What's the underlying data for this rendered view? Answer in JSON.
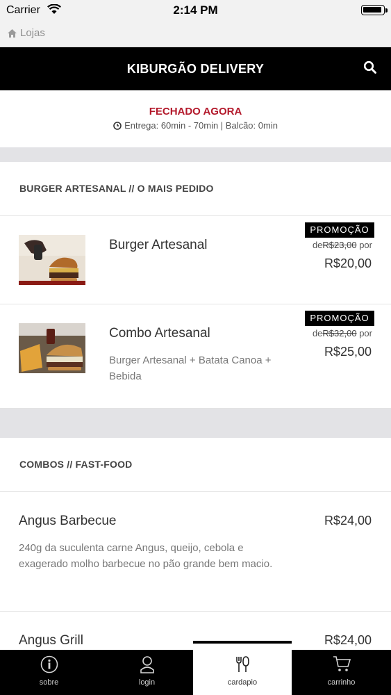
{
  "status_bar": {
    "carrier": "Carrier",
    "time": "2:14 PM",
    "battery_level": 0.95
  },
  "nav": {
    "back_label": "Lojas"
  },
  "header": {
    "title": "KIBURGÃO DELIVERY",
    "search_icon": "search-icon"
  },
  "store": {
    "status": "FECHADO AGORA",
    "delivery_info": "Entrega: 60min - 70min | Balcão: 0min",
    "status_color": "#b3192b"
  },
  "sections": [
    {
      "title": "BURGER ARTESANAL // O MAIS PEDIDO",
      "items": [
        {
          "name": "Burger Artesanal",
          "badge": "PROMOÇÃO",
          "old_prefix": "de",
          "old_price": "R$23,00",
          "old_suffix": "por",
          "price": "R$20,00"
        },
        {
          "name": "Combo Artesanal",
          "description": "Burger Artesanal + Batata Canoa + Bebida",
          "badge": "PROMOÇÃO",
          "old_prefix": "de",
          "old_price": "R$32,00",
          "old_suffix": "por",
          "price": "R$25,00"
        }
      ]
    },
    {
      "title": "COMBOS // FAST-FOOD",
      "items": [
        {
          "name": "Angus Barbecue",
          "description": "240g da suculenta carne Angus, queijo, cebola e exagerado molho barbecue no pão grande bem macio.",
          "price": "R$24,00"
        },
        {
          "name": "Angus Grill",
          "price": "R$24,00"
        }
      ]
    }
  ],
  "tabs": [
    {
      "label": "sobre",
      "icon": "info-icon"
    },
    {
      "label": "login",
      "icon": "user-icon"
    },
    {
      "label": "cardapio",
      "icon": "cutlery-icon",
      "active": true
    },
    {
      "label": "carrinho",
      "icon": "cart-icon"
    }
  ]
}
